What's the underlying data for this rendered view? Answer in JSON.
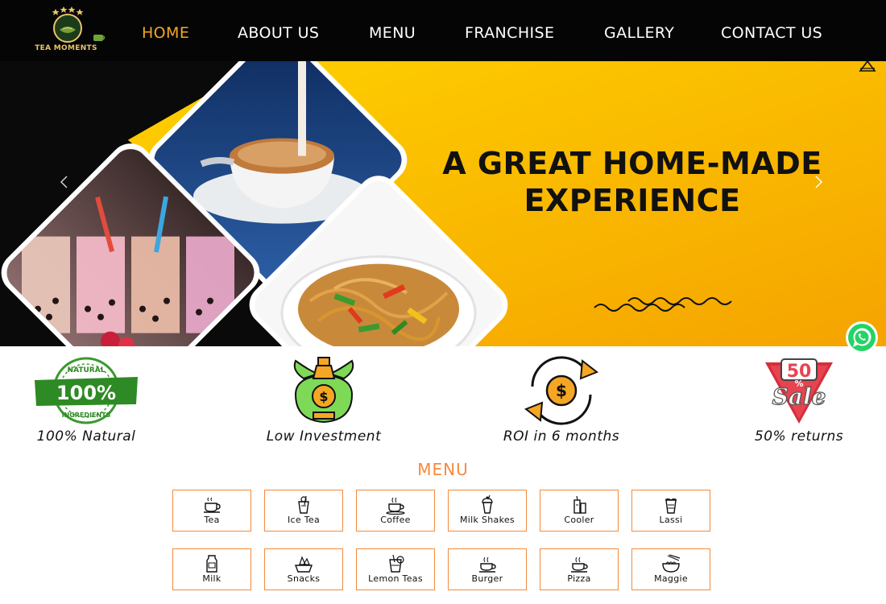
{
  "brand": {
    "name": "TEA MOMENTS",
    "gold": "#e9c46a"
  },
  "colors": {
    "accent": "#f5a623",
    "menu_orange": "#f58a3c",
    "header_bg": "#050505",
    "hero_yellow": "#f6b500"
  },
  "nav": [
    {
      "label": "HOME",
      "active": true
    },
    {
      "label": "ABOUT US"
    },
    {
      "label": "MENU"
    },
    {
      "label": "FRANCHISE"
    },
    {
      "label": "GALLERY"
    },
    {
      "label": "CONTACT US"
    }
  ],
  "hero": {
    "title_line1": "A GREAT HOME-MADE",
    "title_line2": "EXPERIENCE",
    "images": [
      "milk-tea-photo",
      "bubble-tea-photo",
      "noodles-photo"
    ]
  },
  "features": [
    {
      "label": "100% Natural",
      "icon": "natural-badge-icon",
      "badge_text": "100%",
      "badge_top": "NATURAL",
      "badge_bottom": "INGREDIENTS"
    },
    {
      "label": "Low Investment",
      "icon": "money-bag-icon"
    },
    {
      "label": "ROI in 6 months",
      "icon": "dollar-cycle-icon"
    },
    {
      "label": "50% returns",
      "icon": "sale-badge-icon",
      "badge_num": "50",
      "badge_pct": "%",
      "badge_word": "Sale"
    }
  ],
  "menu": {
    "heading": "MENU",
    "items": [
      {
        "label": "Tea",
        "icon": "tea-cup-icon"
      },
      {
        "label": "Ice Tea",
        "icon": "ice-tea-icon"
      },
      {
        "label": "Coffee",
        "icon": "coffee-cup-icon"
      },
      {
        "label": "Milk Shakes",
        "icon": "milkshake-icon"
      },
      {
        "label": "Cooler",
        "icon": "cooler-icon"
      },
      {
        "label": "Lassi",
        "icon": "lassi-icon"
      },
      {
        "label": "Milk",
        "icon": "milk-icon"
      },
      {
        "label": "Snacks",
        "icon": "snacks-icon"
      },
      {
        "label": "Lemon Teas",
        "icon": "lemon-tea-icon"
      },
      {
        "label": "Burger",
        "icon": "burger-icon"
      },
      {
        "label": "Pizza",
        "icon": "pizza-icon"
      },
      {
        "label": "Maggie",
        "icon": "noodle-bowl-icon"
      }
    ]
  }
}
